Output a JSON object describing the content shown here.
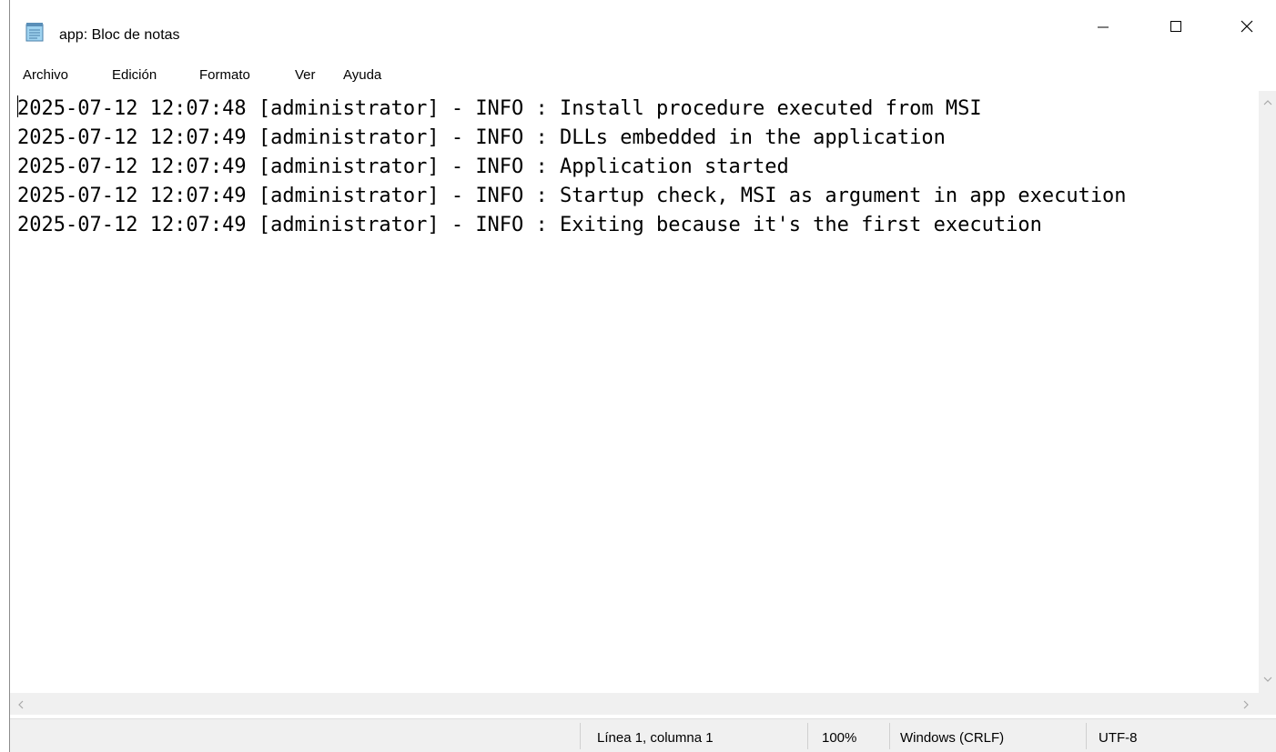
{
  "window": {
    "title": "app: Bloc de notas"
  },
  "menu": {
    "items": [
      "Archivo",
      "Edición",
      "Formato",
      "Ver",
      "Ayuda"
    ]
  },
  "editor": {
    "lines": [
      "2025-07-12 12:07:48 [administrator] - INFO : Install procedure executed from MSI",
      "2025-07-12 12:07:49 [administrator] - INFO : DLLs embedded in the application",
      "2025-07-12 12:07:49 [administrator] - INFO : Application started",
      "2025-07-12 12:07:49 [administrator] - INFO : Startup check, MSI as argument in app execution",
      "2025-07-12 12:07:49 [administrator] - INFO : Exiting because it's the first execution"
    ]
  },
  "status": {
    "position": "Línea 1, columna 1",
    "zoom": "100%",
    "line_ending": "Windows (CRLF)",
    "encoding": "UTF-8"
  },
  "icons": {
    "app": "notepad-icon",
    "minimize": "minimize-icon",
    "maximize": "maximize-icon",
    "close": "close-icon"
  }
}
